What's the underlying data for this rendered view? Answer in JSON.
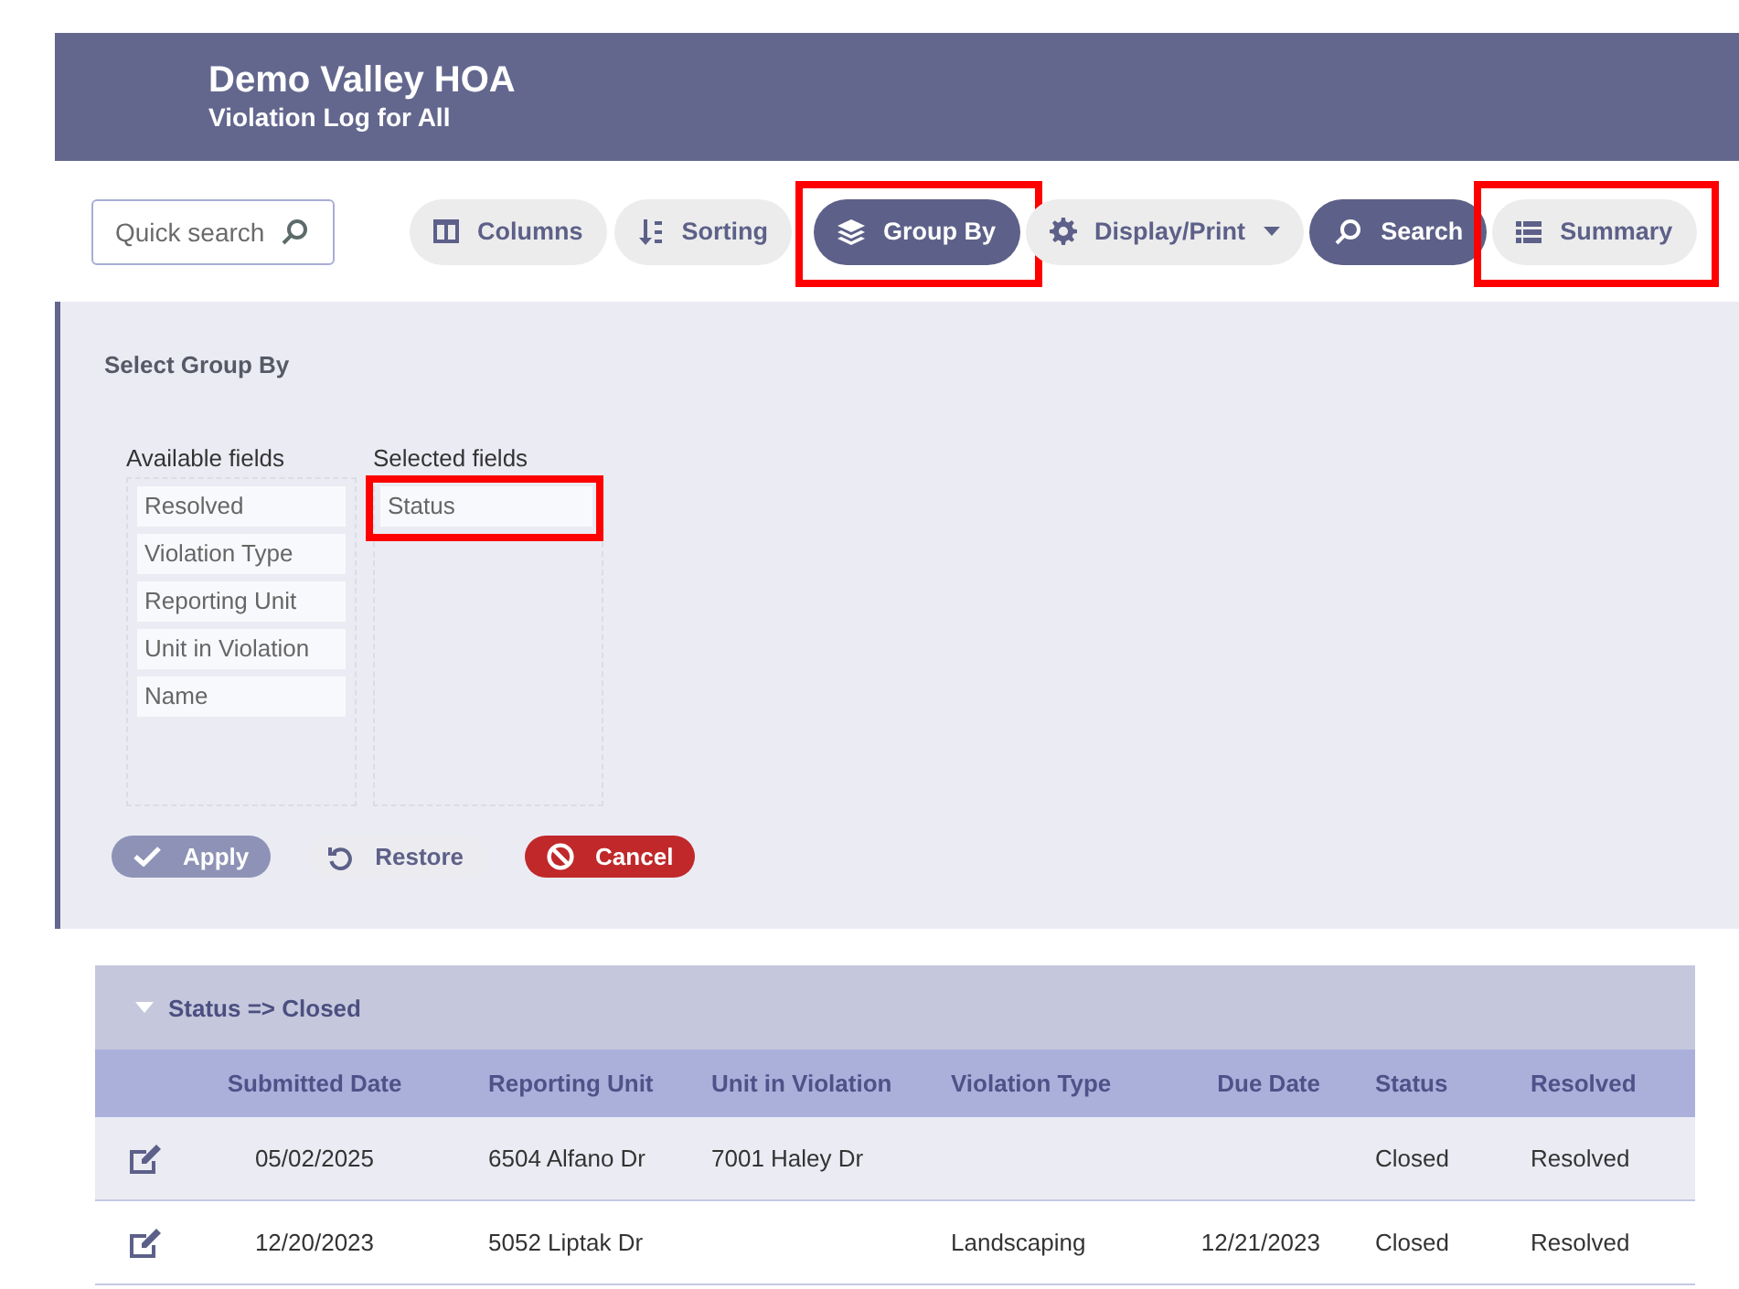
{
  "header": {
    "title": "Demo Valley HOA",
    "subtitle": "Violation Log for All"
  },
  "toolbar": {
    "search": {
      "placeholder": "Quick search"
    },
    "buttons": [
      {
        "label": "Columns",
        "active": false,
        "dropdown": false,
        "highlighted": false
      },
      {
        "label": "Sorting",
        "active": false,
        "dropdown": false,
        "highlighted": false
      },
      {
        "label": "Group By",
        "active": true,
        "dropdown": false,
        "highlighted": true
      },
      {
        "label": "Display/Print",
        "active": false,
        "dropdown": true,
        "highlighted": false
      },
      {
        "label": "Search",
        "active": true,
        "dropdown": false,
        "highlighted": false
      },
      {
        "label": "Summary",
        "active": false,
        "dropdown": false,
        "highlighted": true
      }
    ]
  },
  "group_by": {
    "title": "Select Group By",
    "available": {
      "label": "Available fields",
      "items": [
        {
          "label": "Resolved",
          "highlighted": false
        },
        {
          "label": "Violation Type",
          "highlighted": false
        },
        {
          "label": "Reporting Unit",
          "highlighted": false
        },
        {
          "label": "Unit in Violation",
          "highlighted": false
        },
        {
          "label": "Name",
          "highlighted": false
        }
      ]
    },
    "selected": {
      "label": "Selected fields",
      "items": [
        {
          "label": "Status",
          "highlighted": true
        }
      ]
    },
    "actions": [
      {
        "label": "Apply",
        "kind": "apply",
        "disabled": true
      },
      {
        "label": "Restore",
        "kind": "restore",
        "disabled": false
      },
      {
        "label": "Cancel",
        "kind": "cancel",
        "disabled": false
      }
    ]
  },
  "grid": {
    "group": {
      "label": "Status => Closed",
      "expanded": true
    },
    "columns": [
      "Submitted Date",
      "Reporting Unit",
      "Unit in Violation",
      "Violation Type",
      "Due Date",
      "Status",
      "Resolved"
    ],
    "rows": [
      {
        "cells": [
          "05/02/2025",
          "6504 Alfano Dr",
          "7001 Haley Dr",
          "",
          "",
          "Closed",
          "Resolved"
        ]
      },
      {
        "cells": [
          "12/20/2023",
          "5052 Liptak Dr",
          "",
          "Landscaping",
          "12/21/2023",
          "Closed",
          "Resolved"
        ]
      }
    ]
  }
}
